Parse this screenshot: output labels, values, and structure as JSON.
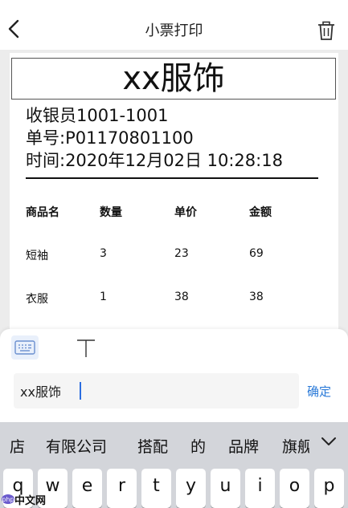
{
  "nav": {
    "title": "小票打印"
  },
  "receipt": {
    "shop_name": "xx服饰",
    "cashier": "收银员1001-1001",
    "order_no": "单号:P01170801100",
    "time": "时间:2020年12月02日 10:28:18",
    "columns": [
      "商品名",
      "数量",
      "单价",
      "金额"
    ],
    "rows": [
      [
        "短袖",
        "3",
        "23",
        "69"
      ],
      [
        "衣服",
        "1",
        "38",
        "38"
      ]
    ]
  },
  "editor": {
    "input_value": "xx服饰",
    "confirm_label": "确定",
    "text_tool_glyph": "T"
  },
  "keyboard": {
    "candidates": [
      "店",
      "有限公司",
      "搭配",
      "的",
      "品牌",
      "旗舰"
    ],
    "keys": [
      "q",
      "w",
      "e",
      "r",
      "t",
      "y",
      "u",
      "i",
      "o",
      "p"
    ]
  },
  "watermark": {
    "text": "中文网"
  },
  "icons": {
    "back": "chevron-left-icon",
    "trash": "trash-icon",
    "keyboard": "keyboard-icon",
    "text": "text-tool-icon",
    "expand": "chevron-down-icon"
  },
  "colors": {
    "accent": "#2a7ad8",
    "keyboard_bg": "#d3d5da"
  }
}
